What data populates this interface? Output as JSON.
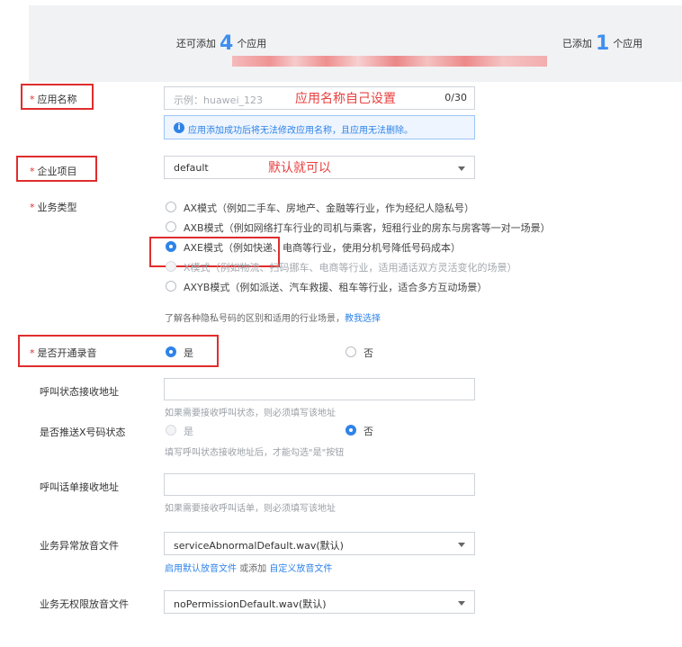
{
  "header": {
    "remaining_prefix": "还可添加",
    "remaining_count": "4",
    "remaining_suffix": "个应用",
    "added_prefix": "已添加",
    "added_count": "1",
    "added_suffix": "个应用"
  },
  "app_name": {
    "label": "应用名称",
    "placeholder": "示例：huawei_123",
    "counter": "0/30",
    "annotation": "应用名称自己设置",
    "info": "应用添加成功后将无法修改应用名称，且应用无法删除。"
  },
  "project": {
    "label": "企业项目",
    "value": "default",
    "annotation": "默认就可以"
  },
  "business_type": {
    "label": "业务类型",
    "options": [
      {
        "label": "AX模式（例如二手车、房地产、金融等行业，作为经纪人隐私号）",
        "state": "unchecked"
      },
      {
        "label": "AXB模式（例如网络打车行业的司机与乘客，短租行业的房东与房客等一对一场景）",
        "state": "unchecked"
      },
      {
        "label": "AXE模式（例如快递、电商等行业，使用分机号降低号码成本）",
        "state": "checked"
      },
      {
        "label": "X模式（例如物流、扫码挪车、电商等行业，适用通话双方灵活变化的场景）",
        "state": "disabled"
      },
      {
        "label": "AXYB模式（例如派送、汽车救援、租车等行业，适合多方互动场景）",
        "state": "unchecked"
      }
    ],
    "help_text": "了解各种隐私号码的区别和适用的行业场景，",
    "help_link": "教我选择"
  },
  "recording": {
    "label": "是否开通录音",
    "yes": "是",
    "no": "否"
  },
  "call_status_url": {
    "label": "呼叫状态接收地址",
    "value": "",
    "hint": "如果需要接收呼叫状态，则必须填写该地址"
  },
  "push_x_status": {
    "label": "是否推送X号码状态",
    "yes": "是",
    "no": "否",
    "hint": "填写呼叫状态接收地址后，才能勾选\"是\"按钮"
  },
  "call_bill_url": {
    "label": "呼叫话单接收地址",
    "value": "",
    "hint": "如果需要接收呼叫话单，则必须填写该地址"
  },
  "abnormal_audio": {
    "label": "业务异常放音文件",
    "value": "serviceAbnormalDefault.wav(默认)",
    "link_enable": "启用默认放音文件",
    "link_or": "或添加",
    "link_custom": "自定义放音文件"
  },
  "no_permission_audio": {
    "label": "业务无权限放音文件",
    "value": "noPermissionDefault.wav(默认)"
  },
  "colors": {
    "accent": "#2f83e8",
    "annotation_red": "#e02d2d",
    "redaction": "#f08a8a"
  }
}
